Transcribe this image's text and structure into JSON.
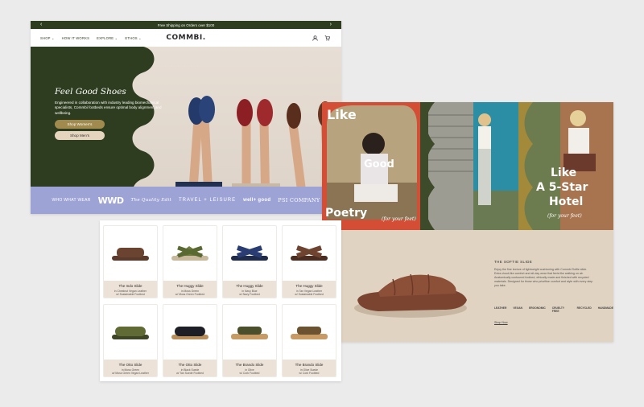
{
  "homepage": {
    "announcement": "Free Shipping on Orders over $100",
    "prev_arrow": "‹",
    "next_arrow": "›",
    "nav": [
      {
        "label": "SHOP ⌄"
      },
      {
        "label": "HOW IT WORKS"
      },
      {
        "label": "EXPLORE ⌄"
      },
      {
        "label": "ETHOS ⌄"
      }
    ],
    "logo": "COMMBI.",
    "icons": [
      "account-icon",
      "cart-icon"
    ],
    "hero": {
      "title": "Feel Good Shoes",
      "body": "Engineered in collaboration with industry leading biomechanical specialists, Commbi footbeds ensure optimal body alignment and wellbeing.",
      "btn_women": "Shop Women's",
      "btn_men": "Shop Men's"
    },
    "press": {
      "p1": "WHO WHAT WEAR",
      "p2": "WWD",
      "p3": "The Quality Edit",
      "p4": "TRAVEL + LEISURE",
      "p5": "well+ good",
      "p6": "PSI COMPANY"
    },
    "colors": {
      "green": "#2e3d1f",
      "lavender": "#9ea3d6",
      "gold": "#a08a4d"
    }
  },
  "editorial": {
    "like": "Like",
    "good": "Good",
    "poetry": "Poetry",
    "for_feet": "(for your feet)",
    "like2": "Like",
    "five_star": "A 5-Star",
    "hotel": "Hotel",
    "for_feet2": "(for your feet)",
    "product_title": "THE SOFTIE SLIDE",
    "product_desc": "Enjoy the fine texture of lightweight cushioning with Commbi Softie slide. Extra cloud-like comfort and all-day wear that feels like walking on air. Anatomically contoured footbed, ethically made and finished with recycled materials. Designed for those who prioritise comfort and style with every step you take.",
    "logos": [
      "LEATHER",
      "VEGAN",
      "ERGONOMIC",
      "CRUELTY FREE",
      "RECYCLED",
      "HANDMADE"
    ],
    "shop_link": "Shop Now"
  },
  "products": [
    {
      "name": "The Indo Slide",
      "sub1": "in Chestnut Vegan Leather",
      "sub2": "w/ Sustainable Footbed"
    },
    {
      "name": "The Huggy Slide",
      "sub1": "in Moss Green",
      "sub2": "w/ Moss Green Footbed"
    },
    {
      "name": "The Huggy Slide",
      "sub1": "in Navy Blue",
      "sub2": "w/ Navy Footbed"
    },
    {
      "name": "The Huggy Slide",
      "sub1": "in Tan Vegan Leather",
      "sub2": "w/ Sustainable Footbed"
    },
    {
      "name": "The Otto Slide",
      "sub1": "in Moss Green",
      "sub2": "w/ Moss Green Vegan Leather"
    },
    {
      "name": "The Otto Slide",
      "sub1": "in Black Suede",
      "sub2": "w/ Tan Suede Footbed"
    },
    {
      "name": "The Brando Slide",
      "sub1": "in Olive",
      "sub2": "w/ Cork Footbed"
    },
    {
      "name": "The Brando Slide",
      "sub1": "in Olive Suede",
      "sub2": "w/ Cork Footbed"
    }
  ]
}
